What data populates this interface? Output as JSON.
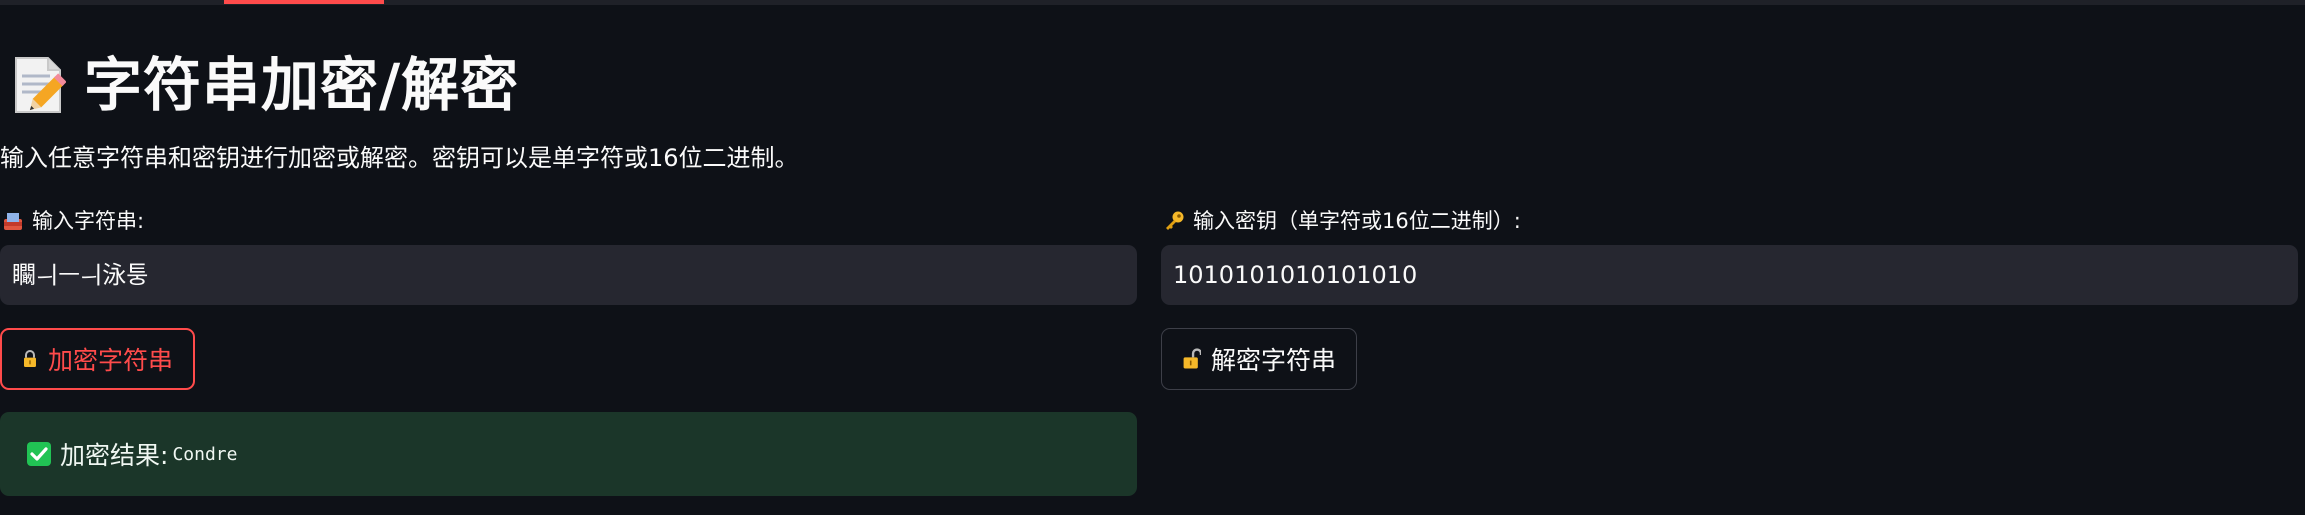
{
  "header": {
    "title": "字符串加密/解密",
    "title_icon": "memo-icon",
    "description": "输入任意字符串和密钥进行加密或解密。密钥可以是单字符或16位二进制。"
  },
  "inputs": {
    "string": {
      "label": "📩 输入字符串:",
      "label_text": "输入字符串:",
      "value": "矙ㅢㅡㅢ泳퉁",
      "icon": "inbox-tray-icon"
    },
    "key": {
      "label_text": "输入密钥（单字符或16位二进制）:",
      "value": "1010101010101010",
      "icon": "key-icon"
    }
  },
  "buttons": {
    "encrypt": {
      "label": "加密字符串",
      "icon": "lock-icon",
      "color": "#ff4b4b"
    },
    "decrypt": {
      "label": "解密字符串",
      "icon": "unlock-icon"
    }
  },
  "result": {
    "label": "加密结果:",
    "value": "Condre",
    "icon": "check-icon",
    "background": "#1b3629"
  },
  "theme": {
    "background": "#0e1117",
    "input_background": "#262730",
    "accent": "#ff4b4b"
  }
}
